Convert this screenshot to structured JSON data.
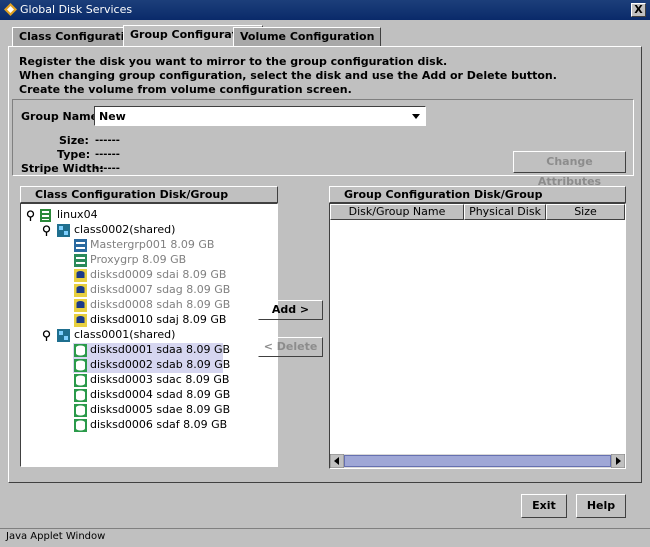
{
  "window": {
    "title": "Global Disk Services",
    "close_label": "X"
  },
  "tabs": [
    {
      "label": "Class Configuration"
    },
    {
      "label": "Group Configuration"
    },
    {
      "label": "Volume Configuration"
    }
  ],
  "instructions": [
    "Register the disk you want to mirror to the group configuration disk.",
    "When changing group configuration, select the disk and use the Add or Delete button.",
    "Create the volume from volume configuration screen."
  ],
  "group": {
    "name_label": "Group Name:",
    "name_value": "New",
    "size_label": "Size:",
    "size_value": "------",
    "type_label": "Type:",
    "type_value": "------",
    "stripe_label": "Stripe Width:",
    "stripe_value": "------",
    "change_button": "Change Attributes"
  },
  "left_panel": {
    "title": "Class Configuration Disk/Group",
    "tree": {
      "root": "linux04",
      "class0002": "class0002(shared)",
      "class0002_items": [
        {
          "label": "Mastergrp001   8.09 GB"
        },
        {
          "label": "Proxygrp   8.09 GB"
        },
        {
          "label": "disksd0009   sdai   8.09 GB"
        },
        {
          "label": "disksd0007   sdag   8.09 GB"
        },
        {
          "label": "disksd0008   sdah   8.09 GB"
        },
        {
          "label": "disksd0010   sdaj   8.09 GB"
        }
      ],
      "class0001": "class0001(shared)",
      "class0001_items": [
        {
          "label": "disksd0001   sdaa   8.09 GB"
        },
        {
          "label": "disksd0002   sdab   8.09 GB"
        },
        {
          "label": "disksd0003   sdac   8.09 GB"
        },
        {
          "label": "disksd0004   sdad   8.09 GB"
        },
        {
          "label": "disksd0005   sdae   8.09 GB"
        },
        {
          "label": "disksd0006   sdaf   8.09 GB"
        }
      ]
    }
  },
  "actions": {
    "add": "Add >",
    "delete": "< Delete"
  },
  "right_panel": {
    "title": "Group Configuration Disk/Group",
    "columns": [
      "Disk/Group Name",
      "Physical Disk",
      "Size"
    ]
  },
  "footer": {
    "exit": "Exit",
    "help": "Help"
  },
  "status": "Java Applet Window"
}
